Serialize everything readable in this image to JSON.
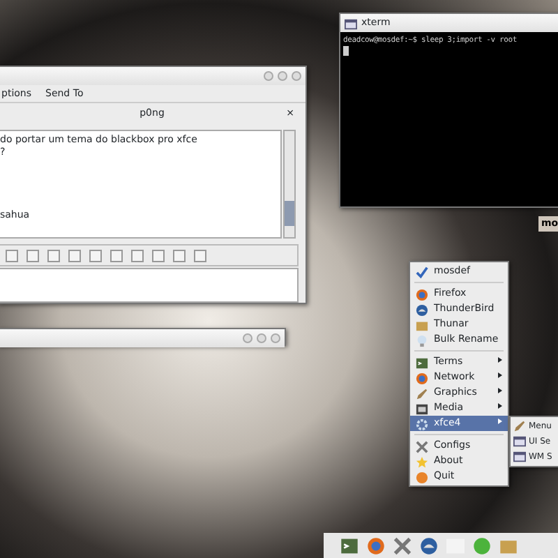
{
  "chat_window": {
    "menu": [
      "ptions",
      "Send To"
    ],
    "tab": {
      "title": "p0ng",
      "close": "×"
    },
    "messages": [
      "do portar um tema do blackbox pro xfce",
      "?",
      "sahua"
    ]
  },
  "xterm": {
    "title": "xterm",
    "lines": [
      "deadcow@mosdef:~$ sleep 3;import -v root"
    ]
  },
  "desktop_label": "mo",
  "menu": {
    "items": [
      {
        "kind": "item",
        "label": "mosdef",
        "submenu": false,
        "selected": false
      },
      {
        "kind": "separator"
      },
      {
        "kind": "item",
        "label": "Firefox",
        "submenu": false,
        "selected": false
      },
      {
        "kind": "item",
        "label": "ThunderBird",
        "submenu": false,
        "selected": false
      },
      {
        "kind": "item",
        "label": "Thunar",
        "submenu": false,
        "selected": false
      },
      {
        "kind": "item",
        "label": "Bulk Rename",
        "submenu": false,
        "selected": false
      },
      {
        "kind": "separator"
      },
      {
        "kind": "item",
        "label": "Terms",
        "submenu": true,
        "selected": false
      },
      {
        "kind": "item",
        "label": "Network",
        "submenu": true,
        "selected": false
      },
      {
        "kind": "item",
        "label": "Graphics",
        "submenu": true,
        "selected": false
      },
      {
        "kind": "item",
        "label": "Media",
        "submenu": true,
        "selected": false
      },
      {
        "kind": "item",
        "label": "xfce4",
        "submenu": true,
        "selected": true
      },
      {
        "kind": "separator"
      },
      {
        "kind": "item",
        "label": "Configs",
        "submenu": false,
        "selected": false
      },
      {
        "kind": "item",
        "label": "About",
        "submenu": false,
        "selected": false
      },
      {
        "kind": "item",
        "label": "Quit",
        "submenu": false,
        "selected": false
      }
    ],
    "submenu": [
      {
        "label": "Menu"
      },
      {
        "label": "UI Se"
      },
      {
        "label": "WM S"
      }
    ]
  }
}
